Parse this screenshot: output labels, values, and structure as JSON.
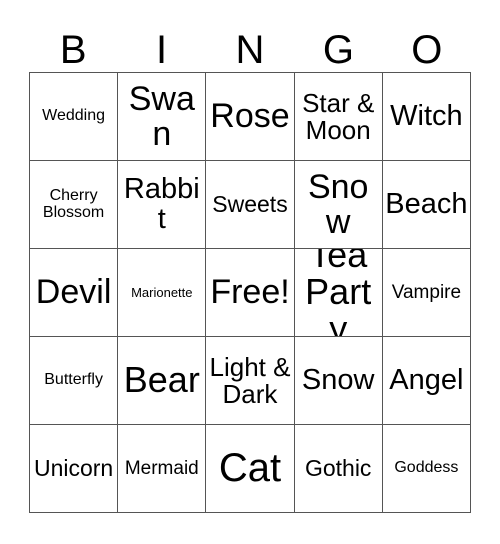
{
  "card": {
    "headers": [
      "B",
      "I",
      "N",
      "G",
      "O"
    ],
    "rows": [
      [
        {
          "label": "Wedding",
          "size": "sm"
        },
        {
          "label": "Swan",
          "size": "3xl"
        },
        {
          "label": "Rose",
          "size": "3xl"
        },
        {
          "label": "Star & Moon",
          "size": "xl"
        },
        {
          "label": "Witch",
          "size": "2xl"
        }
      ],
      [
        {
          "label": "Cherry Blossom",
          "size": "sm"
        },
        {
          "label": "Rabbit",
          "size": "2xl"
        },
        {
          "label": "Sweets",
          "size": "lg"
        },
        {
          "label": "Snow",
          "size": "3xl"
        },
        {
          "label": "Beach",
          "size": "2xl"
        }
      ],
      [
        {
          "label": "Devil",
          "size": "3xl"
        },
        {
          "label": "Marionette",
          "size": "xs"
        },
        {
          "label": "Free!",
          "size": "3xl"
        },
        {
          "label": "Tea Party",
          "size": "4xl"
        },
        {
          "label": "Vampire",
          "size": "md"
        }
      ],
      [
        {
          "label": "Butterfly",
          "size": "sm"
        },
        {
          "label": "Bear",
          "size": "4xl"
        },
        {
          "label": "Light & Dark",
          "size": "xl"
        },
        {
          "label": "Snow",
          "size": "2xl"
        },
        {
          "label": "Angel",
          "size": "2xl"
        }
      ],
      [
        {
          "label": "Unicorn",
          "size": "lg"
        },
        {
          "label": "Mermaid",
          "size": "md"
        },
        {
          "label": "Cat",
          "size": "5xl"
        },
        {
          "label": "Gothic",
          "size": "lg"
        },
        {
          "label": "Goddess",
          "size": "sm"
        }
      ]
    ]
  }
}
